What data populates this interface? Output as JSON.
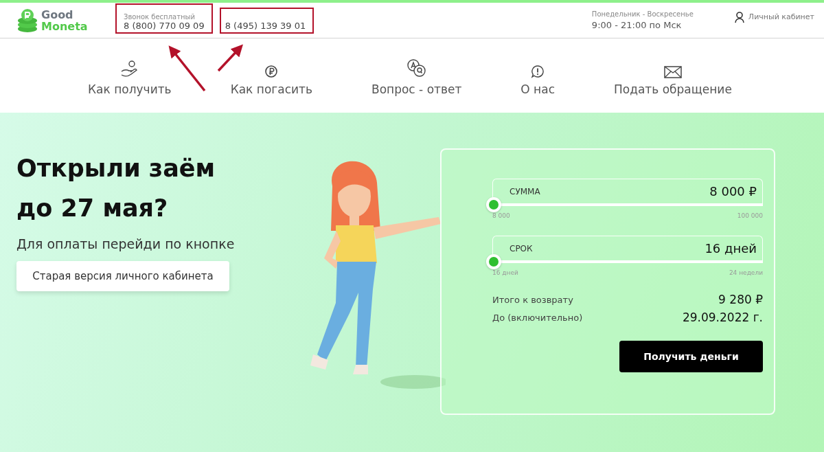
{
  "header": {
    "logo": {
      "line1": "Good",
      "line2": "Moneta"
    },
    "phones": [
      {
        "label": "Звонок бесплатный",
        "number": "8 (800) 770 09 09"
      },
      {
        "number": "8 (495) 139 39 01"
      }
    ],
    "hours": {
      "days": "Понедельник - Воскресенье",
      "time": "9:00 - 21:00 по Мск"
    },
    "account_link": "Личный кабинет"
  },
  "nav": [
    {
      "kind": "hand-coin",
      "label": "Как получить"
    },
    {
      "kind": "ruble",
      "label": "Как погасить"
    },
    {
      "kind": "faq",
      "label": "Вопрос - ответ"
    },
    {
      "kind": "info",
      "label": "О нас"
    },
    {
      "kind": "mail",
      "label": "Подать обращение"
    }
  ],
  "hero": {
    "title_lines": [
      "Открыли заём",
      "до 27 мая?"
    ],
    "subtitle": "Для оплаты перейди по кнопке",
    "button": "Старая версия личного кабинета"
  },
  "calculator": {
    "sliders": [
      {
        "label": "СУММА",
        "value": "8 000 ₽",
        "level": 0,
        "min": "8 000",
        "max": "100 000"
      },
      {
        "label": "СРОК",
        "value": "16 дней",
        "level": 0,
        "min": "16 дней",
        "max": "24 недели"
      }
    ],
    "summary": [
      {
        "label": "Итого к возврату",
        "value": "9 280 ₽"
      },
      {
        "label": "До (включительно)",
        "value": "29.09.2022 г."
      }
    ],
    "button": "Получить деньги"
  }
}
